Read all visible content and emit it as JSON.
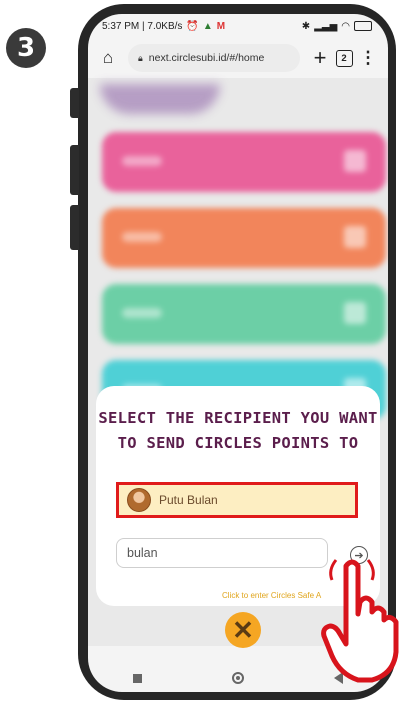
{
  "step_number": "3",
  "status_bar": {
    "time_info": "5:37 PM | 7.0KB/s",
    "mail_icon": "M"
  },
  "browser": {
    "url": "next.circlesubi.id/#/home",
    "tab_count": "2"
  },
  "modal": {
    "title_line1": "SELECT THE RECIPIENT YOU WANT",
    "title_line2": "TO SEND CIRCLES POINTS TO",
    "recipient_name": "Putu Bulan",
    "search_value": "bulan",
    "safe_link": "Click to enter Circles Safe A"
  },
  "colors": {
    "title": "#5b1e4c",
    "highlight_border": "#e01b1b",
    "recipient_bg": "#fdeec2",
    "close_button": "#f5a623",
    "card_pink": "#e9629b",
    "card_orange": "#f2855b",
    "card_green": "#6ccfa6",
    "card_cyan": "#4fd0d6"
  },
  "icons": [
    "home-icon",
    "lock-icon",
    "new-tab-icon",
    "tab-count-icon",
    "menu-icon",
    "arrow-right-icon",
    "close-icon",
    "hand-pointer-icon"
  ]
}
